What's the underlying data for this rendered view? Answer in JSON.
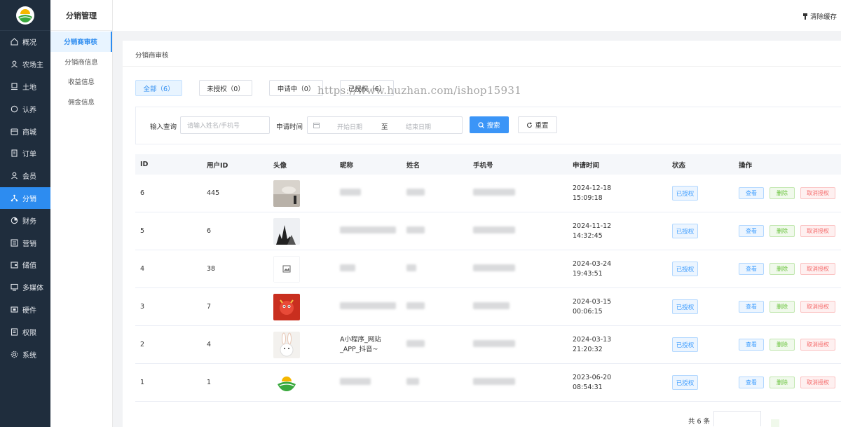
{
  "sidebar": {
    "items": [
      {
        "label": "概况",
        "icon": "home-icon",
        "active": false
      },
      {
        "label": "农场主",
        "icon": "user-icon",
        "active": false
      },
      {
        "label": "土地",
        "icon": "land-icon",
        "active": false
      },
      {
        "label": "认养",
        "icon": "adopt-icon",
        "active": false
      },
      {
        "label": "商城",
        "icon": "shop-icon",
        "active": false
      },
      {
        "label": "订单",
        "icon": "order-icon",
        "active": false
      },
      {
        "label": "会员",
        "icon": "member-icon",
        "active": false
      },
      {
        "label": "分销",
        "icon": "distribution-icon",
        "active": true
      },
      {
        "label": "财务",
        "icon": "finance-icon",
        "active": false
      },
      {
        "label": "营销",
        "icon": "marketing-icon",
        "active": false
      },
      {
        "label": "储值",
        "icon": "wallet-icon",
        "active": false
      },
      {
        "label": "多媒体",
        "icon": "media-icon",
        "active": false
      },
      {
        "label": "硬件",
        "icon": "hardware-icon",
        "active": false
      },
      {
        "label": "权限",
        "icon": "permission-icon",
        "active": false
      },
      {
        "label": "系统",
        "icon": "system-icon",
        "active": false
      }
    ]
  },
  "submenu": {
    "title": "分销管理",
    "items": [
      {
        "label": "分销商审核",
        "active": true
      },
      {
        "label": "分销商信息",
        "active": false
      },
      {
        "label": "收益信息",
        "active": false
      },
      {
        "label": "佣金信息",
        "active": false
      }
    ]
  },
  "header": {
    "clear_cache": "清除缓存"
  },
  "page": {
    "title": "分销商审核",
    "tabs": [
      {
        "label": "全部（6）",
        "active": true
      },
      {
        "label": "未授权（0）",
        "active": false
      },
      {
        "label": "申请中（0）",
        "active": false
      },
      {
        "label": "已授权（6）",
        "active": false
      }
    ],
    "watermark": "https://www.huzhan.com/ishop15931"
  },
  "filter": {
    "query_label": "输入查询",
    "query_placeholder": "请输入姓名/手机号",
    "time_label": "申请时间",
    "start_placeholder": "开始日期",
    "to": "至",
    "end_placeholder": "结束日期",
    "search": "搜索",
    "reset": "重置"
  },
  "table": {
    "headers": [
      "ID",
      "用户ID",
      "头像",
      "昵称",
      "姓名",
      "手机号",
      "申请时间",
      "状态",
      "操作"
    ],
    "rows": [
      {
        "id": "6",
        "uid": "445",
        "nickname": "",
        "date": "2024-12-18",
        "time": "15:09:18",
        "status": "已授权"
      },
      {
        "id": "5",
        "uid": "6",
        "nickname": "",
        "date": "2024-11-12",
        "time": "14:32:45",
        "status": "已授权"
      },
      {
        "id": "4",
        "uid": "38",
        "nickname": "",
        "date": "2024-03-24",
        "time": "19:43:51",
        "status": "已授权"
      },
      {
        "id": "3",
        "uid": "7",
        "nickname": "",
        "date": "2024-03-15",
        "time": "00:06:15",
        "status": "已授权"
      },
      {
        "id": "2",
        "uid": "4",
        "nickname": "A小程序_网站_APP_抖音~",
        "date": "2024-03-13",
        "time": "21:20:32",
        "status": "已授权"
      },
      {
        "id": "1",
        "uid": "1",
        "nickname": "",
        "date": "2023-06-20",
        "time": "08:54:31",
        "status": "已授权"
      }
    ],
    "ops": {
      "view": "查看",
      "delete": "删除",
      "revoke": "取消授权"
    }
  },
  "footer": {
    "total": "共 6 条"
  },
  "colors": {
    "sidebar": "#1f2d3d",
    "accent": "#2d8cf0",
    "green": "#67c23a",
    "red": "#f56c6c"
  }
}
